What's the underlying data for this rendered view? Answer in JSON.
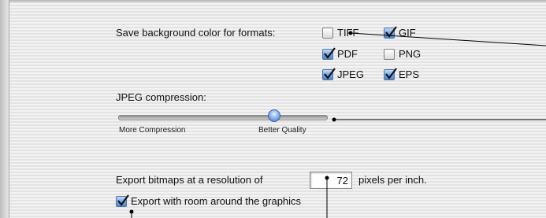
{
  "background_color_label": "Save background color for formats:",
  "formats": [
    {
      "label": "TIFF",
      "checked": false
    },
    {
      "label": "GIF",
      "checked": true
    },
    {
      "label": "PDF",
      "checked": true
    },
    {
      "label": "PNG",
      "checked": false
    },
    {
      "label": "JPEG",
      "checked": true
    },
    {
      "label": "EPS",
      "checked": true
    }
  ],
  "jpeg": {
    "label": "JPEG compression:",
    "min_label": "More Compression",
    "max_label": "Better Quality",
    "value_fraction": 0.75
  },
  "resolution": {
    "prefix": "Export bitmaps at a resolution of",
    "value": "72",
    "suffix": "pixels per inch."
  },
  "export_room": {
    "label": "Export with room around the graphics",
    "checked": true
  }
}
